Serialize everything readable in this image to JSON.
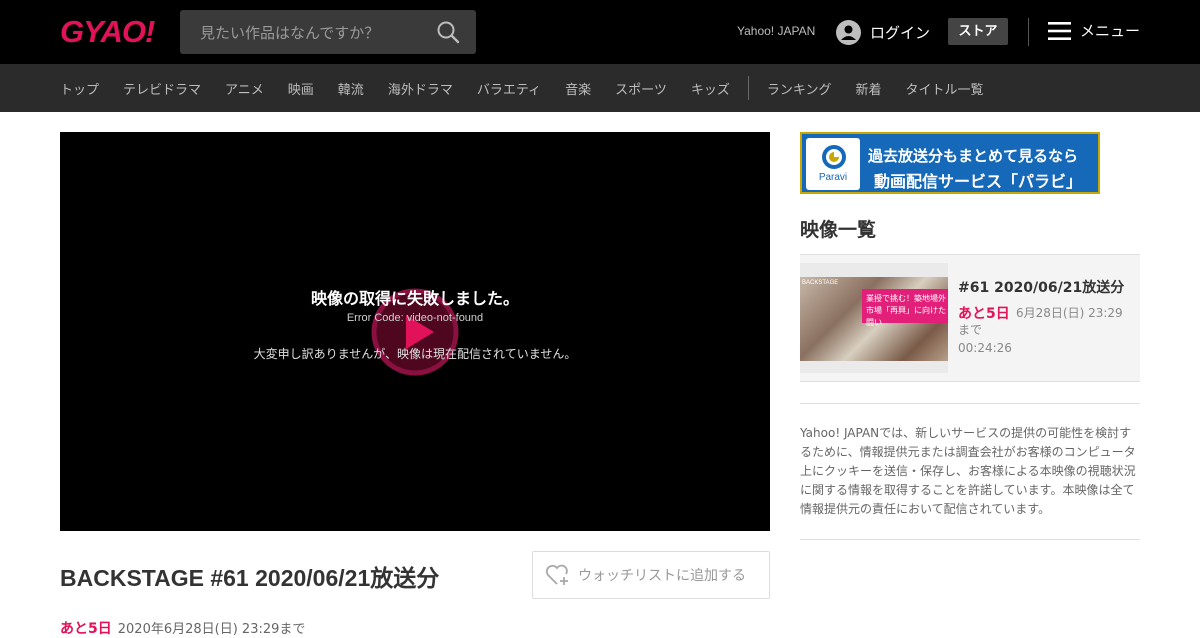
{
  "header": {
    "logo": "GYAO!",
    "search_placeholder": "見たい作品はなんですか？",
    "yahoo_link": "Yahoo! JAPAN",
    "login_label": "ログイン",
    "store_label": "ストア",
    "menu_label": "メニュー"
  },
  "nav": {
    "items": [
      "トップ",
      "テレビドラマ",
      "アニメ",
      "映画",
      "韓流",
      "海外ドラマ",
      "バラエティ",
      "音楽",
      "スポーツ",
      "キッズ"
    ],
    "extra_items": [
      "ランキング",
      "新着",
      "タイトル一覧"
    ]
  },
  "player": {
    "error_title": "映像の取得に失敗しました。",
    "error_code": "Error Code: video-not-found",
    "error_message": "大変申し訳ありませんが、映像は現在配信されていません。"
  },
  "video": {
    "title": "BACKSTAGE #61 2020/06/21放送分",
    "watchlist_label": "ウォッチリストに追加する",
    "remaining": "あと5日",
    "available_until": "2020年6月28日(日) 23:29まで"
  },
  "sidebar": {
    "banner": {
      "logo_text": "Paravi",
      "line1": "過去放送分もまとめて見るなら",
      "line2": "動画配信サービス「パラビ」"
    },
    "heading": "映像一覧",
    "episodes": [
      {
        "thumb_tag": "BACKSTAGE",
        "thumb_caption": "業授で挑む！築地場外市場「再興」に向けた闘い",
        "title": "#61 2020/06/21放送分",
        "remaining": "あと5日",
        "until": "6月28日(日) 23:29まで",
        "duration": "00:24:26"
      }
    ],
    "notice": "Yahoo! JAPANでは、新しいサービスの提供の可能性を検討するために、情報提供元または調査会社がお客様のコンピュータ上にクッキーを送信・保存し、お客様による本映像の視聴状況に関する情報を取得することを許諾しています。本映像は全て情報提供元の責任において配信されています。"
  },
  "colors": {
    "brand": "#e1125a",
    "header_bg": "#000000",
    "nav_bg": "#2b2b2b",
    "paravi_blue": "#1668b8"
  }
}
